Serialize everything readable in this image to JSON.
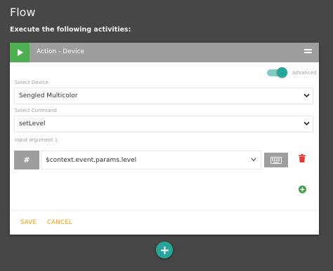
{
  "page": {
    "title": "Flow",
    "subtitle": "Execute the following activities:"
  },
  "card": {
    "header_title": "Action - Device",
    "advanced_label": "Advanced",
    "advanced_on": true,
    "device": {
      "label": "Select Device",
      "value": "Sengled Multicolor"
    },
    "command": {
      "label": "Select Command",
      "value": "setLevel"
    },
    "argument": {
      "label": "Input argument 1",
      "type_symbol": "#",
      "value": "$context.event.params.level"
    },
    "footer": {
      "save": "SAVE",
      "cancel": "CANCEL"
    }
  },
  "icons": {
    "play": "play-icon",
    "menu": "menu-icon",
    "keyboard": "keyboard-icon",
    "delete": "trash-icon",
    "add": "plus-icon"
  },
  "colors": {
    "background": "#474747",
    "header": "#9e9e9e",
    "play": "#4caf50",
    "accent": "#26a69a",
    "delete": "#e53935",
    "footer_text": "#ff9800",
    "add_small": "#43a047"
  }
}
